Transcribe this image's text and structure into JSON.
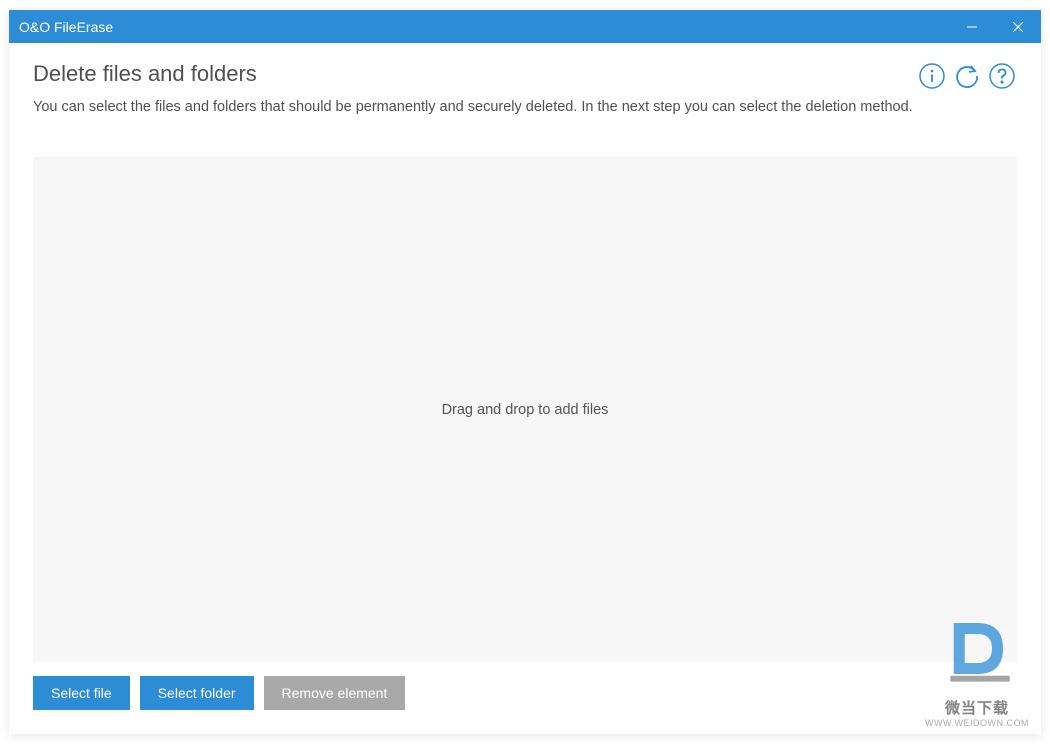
{
  "window": {
    "title": "O&O FileErase"
  },
  "page": {
    "title": "Delete files and folders",
    "description": "You can select the files and folders that should be permanently and securely deleted. In the next step you can select the deletion method."
  },
  "dropzone": {
    "hint": "Drag and drop to add files"
  },
  "buttons": {
    "select_file": "Select file",
    "select_folder": "Select folder",
    "remove_element": "Remove element"
  },
  "watermark": {
    "line1": "微当下载",
    "line2": "WWW.WEIDOWN.COM"
  },
  "colors": {
    "accent": "#2c8cd6",
    "disabled": "#a8a8a8",
    "dropzone_bg": "#f7f7f7"
  }
}
